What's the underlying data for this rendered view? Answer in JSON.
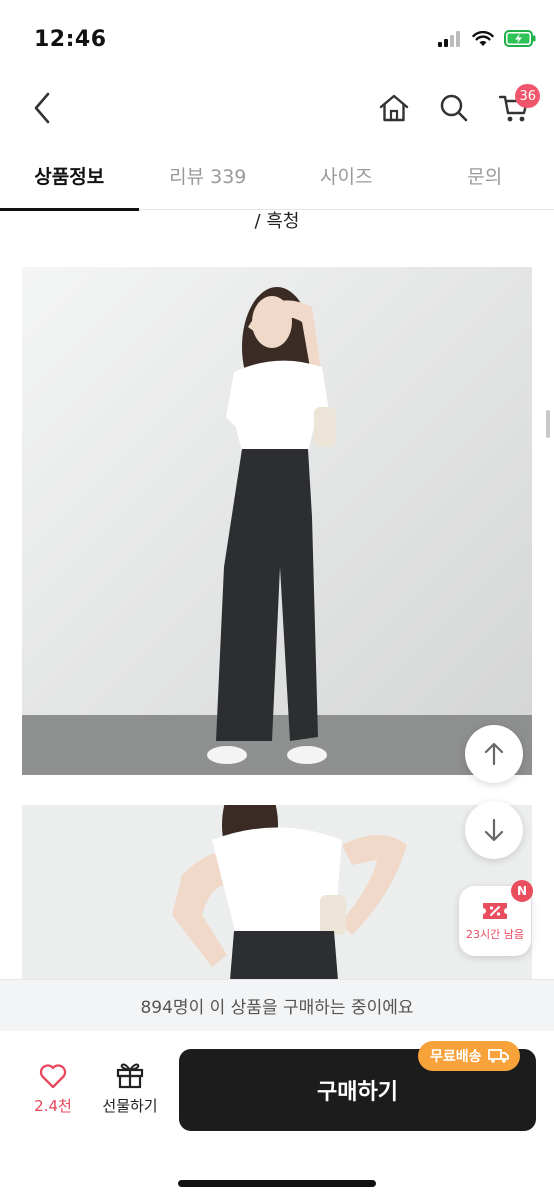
{
  "status_bar": {
    "time": "12:46"
  },
  "header": {
    "cart_count": "36"
  },
  "tabs": [
    {
      "label": "상품정보",
      "active": true
    },
    {
      "label": "리뷰 339",
      "active": false
    },
    {
      "label": "사이즈",
      "active": false
    },
    {
      "label": "문의",
      "active": false
    }
  ],
  "content": {
    "color_text": "/ 흑청"
  },
  "floating": {
    "coupon_label": "23시간 남음",
    "coupon_badge": "N"
  },
  "banner": {
    "text": "894명이 이 상품을 구매하는 중이에요"
  },
  "bottom_bar": {
    "like_count": "2.4천",
    "gift_label": "선물하기",
    "buy_label": "구매하기",
    "free_shipping_label": "무료배송"
  },
  "colors": {
    "accent": "#e9485c",
    "buy_button": "#1c1c1c",
    "free_shipping": "#f7a23b",
    "badge": "#f0566b"
  },
  "icons": [
    "back-icon",
    "home-icon",
    "search-icon",
    "cart-icon",
    "arrow-up-icon",
    "arrow-down-icon",
    "coupon-icon",
    "heart-icon",
    "gift-icon",
    "truck-icon"
  ]
}
